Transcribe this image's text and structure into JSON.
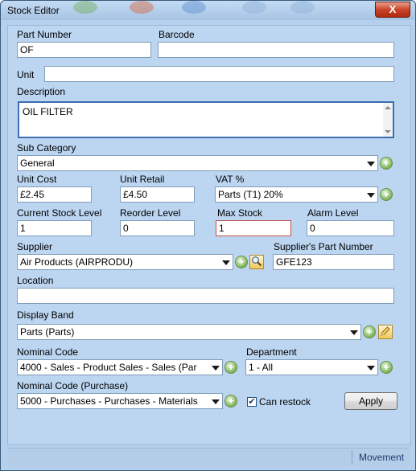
{
  "window": {
    "title": "Stock Editor",
    "close_symbol": "X"
  },
  "fields": {
    "part_number": {
      "label": "Part Number",
      "value": "OF"
    },
    "barcode": {
      "label": "Barcode",
      "value": ""
    },
    "unit": {
      "label": "Unit",
      "value": ""
    },
    "description": {
      "label": "Description",
      "value": "OIL FILTER"
    },
    "sub_category": {
      "label": "Sub Category",
      "value": "General"
    },
    "unit_cost": {
      "label": "Unit Cost",
      "value": "£2.45"
    },
    "unit_retail": {
      "label": "Unit Retail",
      "value": "£4.50"
    },
    "vat": {
      "label": "VAT %",
      "value": "Parts (T1) 20%"
    },
    "current_stock": {
      "label": "Current Stock Level",
      "value": "1"
    },
    "reorder_level": {
      "label": "Reorder Level",
      "value": "0"
    },
    "max_stock": {
      "label": "Max Stock",
      "value": "1"
    },
    "alarm_level": {
      "label": "Alarm Level",
      "value": "0"
    },
    "supplier": {
      "label": "Supplier",
      "value": "Air Products (AIRPRODU)"
    },
    "supplier_part_number": {
      "label": "Supplier's Part Number",
      "value": "GFE123"
    },
    "location": {
      "label": "Location",
      "value": ""
    },
    "display_band": {
      "label": "Display Band",
      "value": "Parts (Parts)"
    },
    "nominal_code": {
      "label": "Nominal Code",
      "value": "4000 - Sales - Product Sales - Sales (Par"
    },
    "department": {
      "label": "Department",
      "value": "1 - All"
    },
    "nominal_code_purchase": {
      "label": "Nominal Code (Purchase)",
      "value": "5000 - Purchases - Purchases - Materials"
    }
  },
  "can_restock": {
    "label": "Can restock",
    "checked": true,
    "check_glyph": "✔"
  },
  "buttons": {
    "apply": "Apply",
    "add_symbol": "+"
  },
  "statusbar": {
    "movement": "Movement"
  },
  "colors": {
    "window_bg": "#bcd5f1",
    "accent": "#3c6fb0",
    "max_stock_border": "#c0504d"
  }
}
